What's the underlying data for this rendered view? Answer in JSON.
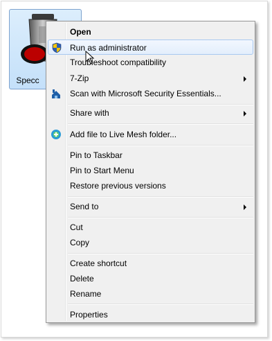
{
  "desktop_icon": {
    "label": "Specc",
    "icon": "speccy-app-icon"
  },
  "context_menu": {
    "items": [
      {
        "label": "Open",
        "bold": true
      },
      {
        "label": "Run as administrator",
        "icon": "uac-shield-icon",
        "highlighted": true
      },
      {
        "label": "Troubleshoot compatibility"
      },
      {
        "label": "7-Zip",
        "submenu": true
      },
      {
        "label": "Scan with Microsoft Security Essentials...",
        "icon": "security-essentials-icon"
      },
      {
        "label": "Share with",
        "submenu": true
      },
      {
        "label": "Add file to Live Mesh folder...",
        "icon": "live-mesh-icon"
      },
      {
        "label": "Pin to Taskbar"
      },
      {
        "label": "Pin to Start Menu"
      },
      {
        "label": "Restore previous versions"
      },
      {
        "label": "Send to",
        "submenu": true
      },
      {
        "label": "Cut"
      },
      {
        "label": "Copy"
      },
      {
        "label": "Create shortcut"
      },
      {
        "label": "Delete"
      },
      {
        "label": "Rename"
      },
      {
        "label": "Properties"
      }
    ]
  },
  "colors": {
    "menu_background": "#f0f0f0",
    "highlight_border": "#a8c8f0",
    "selection_background": "#c4e0fa"
  }
}
